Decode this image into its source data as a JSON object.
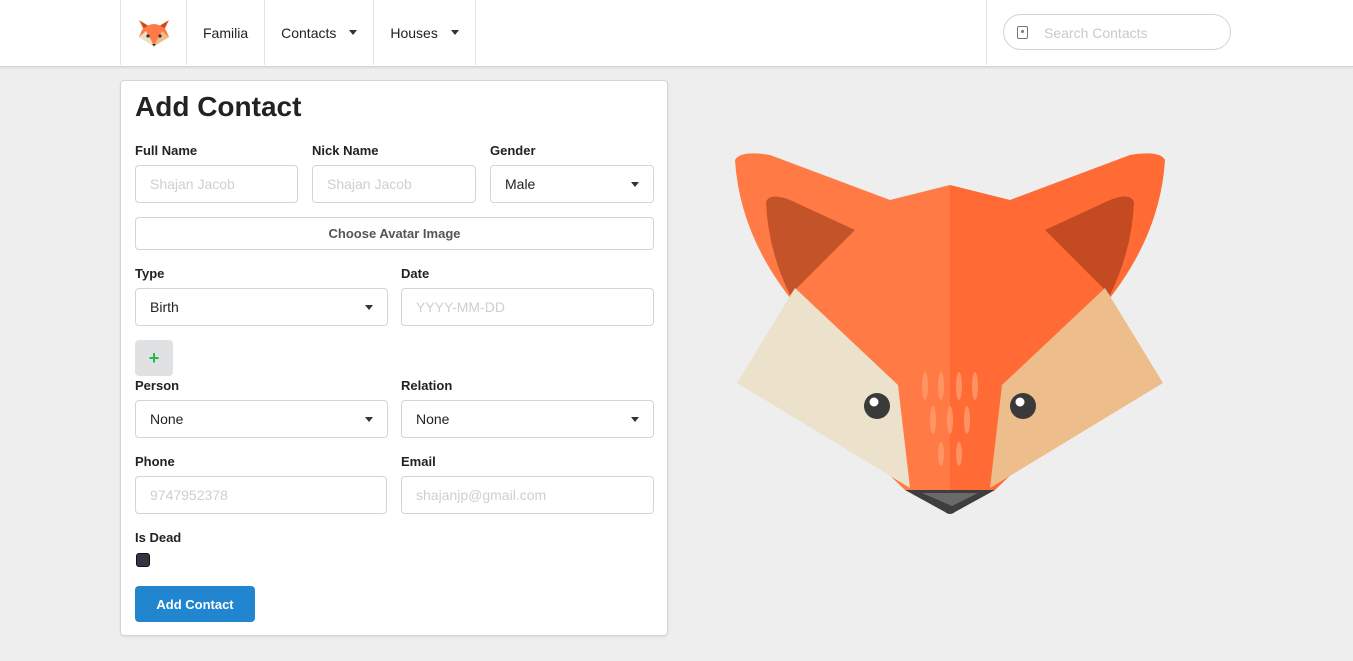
{
  "nav": {
    "brand": "Familia",
    "contacts": "Contacts",
    "houses": "Houses",
    "search_placeholder": "Search Contacts",
    "logo_icon": "fox-logo-icon"
  },
  "form": {
    "title": "Add Contact",
    "full_name": {
      "label": "Full Name",
      "placeholder": "Shajan Jacob"
    },
    "nick_name": {
      "label": "Nick Name",
      "placeholder": "Shajan Jacob"
    },
    "gender": {
      "label": "Gender",
      "value": "Male"
    },
    "avatar_button": "Choose Avatar Image",
    "type": {
      "label": "Type",
      "value": "Birth"
    },
    "date": {
      "label": "Date",
      "placeholder": "YYYY-MM-DD"
    },
    "add_event_button": "+",
    "person": {
      "label": "Person",
      "value": "None"
    },
    "relation": {
      "label": "Relation",
      "value": "None"
    },
    "phone": {
      "label": "Phone",
      "placeholder": "9747952378"
    },
    "email": {
      "label": "Email",
      "placeholder": "shajanjp@gmail.com"
    },
    "is_dead": {
      "label": "Is Dead",
      "checked": true
    },
    "submit": "Add Contact"
  },
  "illustration": {
    "icon": "fox-face-icon"
  },
  "colors": {
    "primary": "#2185d0",
    "plus": "#21ba45",
    "fox_orange": "#ff7a45",
    "fox_dark": "#c44a22"
  }
}
